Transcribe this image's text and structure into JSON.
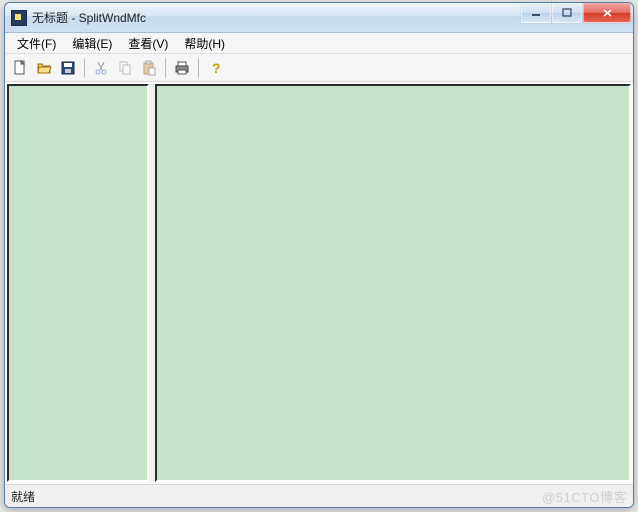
{
  "titlebar": {
    "title": "无标题 - SplitWndMfc"
  },
  "menu": {
    "file": "文件(F)",
    "edit": "编辑(E)",
    "view": "查看(V)",
    "help": "帮助(H)"
  },
  "toolbar": {
    "new": "new-file-icon",
    "open": "open-file-icon",
    "save": "save-icon",
    "cut": "cut-icon",
    "copy": "copy-icon",
    "paste": "paste-icon",
    "print": "print-icon",
    "help": "help-icon"
  },
  "statusbar": {
    "ready": "就绪",
    "watermark": "@51CTO博客"
  },
  "colors": {
    "pane_bg": "#c7e3c7",
    "title_gradient_top": "#f0f5fb",
    "title_gradient_bottom": "#d0e0f2",
    "close_red": "#d13a2a"
  }
}
